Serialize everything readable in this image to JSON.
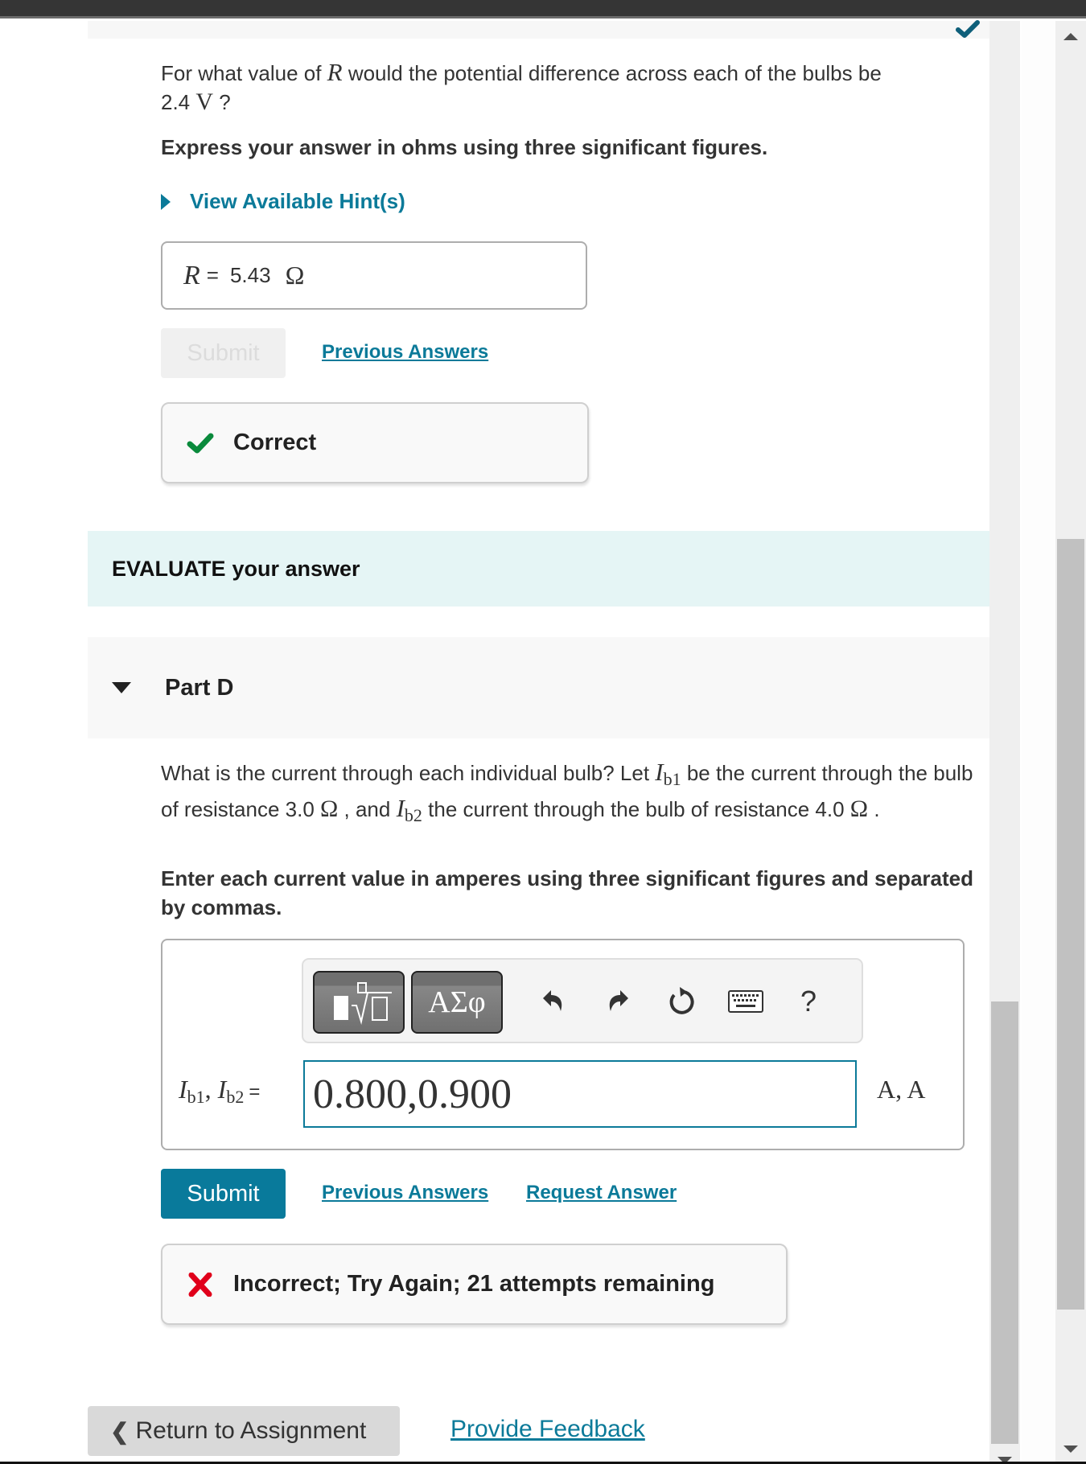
{
  "part_c": {
    "question_prefix": "For what value of ",
    "question_var": "R",
    "question_suffix": " would the potential difference across each of the bulbs be",
    "question_value": "2.4",
    "question_unit": "V",
    "question_end": " ?",
    "instruction": "Express your answer in ohms using three significant figures.",
    "hint_label": "View Available Hint(s)",
    "answer": {
      "variable": "R",
      "equals": "=",
      "value": "5.43",
      "unit": "Ω"
    },
    "submit_label": "Submit",
    "previous_answers_label": "Previous Answers",
    "feedback": {
      "status": "correct",
      "text": "Correct",
      "color": "#0a8a3c"
    }
  },
  "evaluate": {
    "bold": "EVALUATE",
    "rest": "your answer"
  },
  "part_d": {
    "title": "Part D",
    "question": {
      "t1": "What is the current through each individual bulb? Let ",
      "var1": "I",
      "sub1": "b1",
      "t2": " be the current through the bulb of resistance 3.0 ",
      "unit1": "Ω",
      "t3": " , and ",
      "var2": "I",
      "sub2": "b2",
      "t4": " the current through the bulb of resistance 4.0 ",
      "unit2": "Ω",
      "t5": " ."
    },
    "instruction": "Enter each current value in amperes using three significant figures and separated by commas.",
    "toolbar": {
      "templates_label": "templates",
      "greek_label": "ΑΣφ",
      "undo": "undo-icon",
      "redo": "redo-icon",
      "reset": "reset-icon",
      "keyboard": "keyboard-icon",
      "help_label": "?"
    },
    "answer": {
      "lhs_var1": "I",
      "lhs_sub1": "b1",
      "lhs_sep": ", ",
      "lhs_var2": "I",
      "lhs_sub2": "b2",
      "equals": "=",
      "value": "0.800,0.900",
      "units": "A, A"
    },
    "submit_label": "Submit",
    "previous_answers_label": "Previous Answers",
    "request_answer_label": "Request Answer",
    "feedback": {
      "status": "incorrect",
      "text": "Incorrect; Try Again; 21 attempts remaining",
      "color": "#e0001b"
    }
  },
  "footer": {
    "return_label": "Return to Assignment",
    "feedback_link": "Provide Feedback"
  },
  "colors": {
    "accent": "#0b7a99",
    "check_top": "#0e5f7a"
  }
}
